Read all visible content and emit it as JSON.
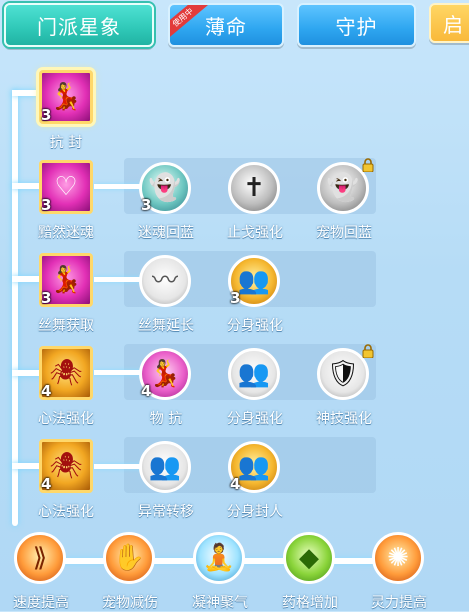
{
  "tabs": [
    {
      "label": "门派星象",
      "active": true
    },
    {
      "label": "薄命",
      "badge": "使用中"
    },
    {
      "label": "守护"
    },
    {
      "label": "启"
    }
  ],
  "tree": {
    "rows": [
      {
        "main": {
          "label": "抗 封",
          "level": "3",
          "icon": "dancer-icon"
        },
        "branches": []
      },
      {
        "main": {
          "label": "黯然迷魂",
          "level": "3",
          "icon": "heart-swirl-icon"
        },
        "branches": [
          {
            "label": "迷魂回蓝",
            "level": "3",
            "icon": "ghost-icon",
            "locked": false
          },
          {
            "label": "止戈强化",
            "level": "",
            "icon": "halberd-icon",
            "locked": false
          },
          {
            "label": "宠物回蓝",
            "level": "",
            "icon": "ghost-icon",
            "locked": true
          }
        ]
      },
      {
        "main": {
          "label": "丝舞获取",
          "level": "3",
          "icon": "dancer-icon"
        },
        "branches": [
          {
            "label": "丝舞延长",
            "level": "",
            "icon": "silk-icon",
            "locked": false
          },
          {
            "label": "分身强化",
            "level": "3",
            "icon": "clone-icon",
            "locked": false
          }
        ]
      },
      {
        "main": {
          "label": "心法强化",
          "level": "4",
          "icon": "spider-icon"
        },
        "branches": [
          {
            "label": "物 抗",
            "level": "4",
            "icon": "dancer-icon",
            "locked": false
          },
          {
            "label": "分身强化",
            "level": "",
            "icon": "clone-icon",
            "locked": false
          },
          {
            "label": "神技强化",
            "level": "",
            "icon": "armor-icon",
            "locked": true
          }
        ]
      },
      {
        "main": {
          "label": "心法强化",
          "level": "4",
          "icon": "spider-icon"
        },
        "branches": [
          {
            "label": "异常转移",
            "level": "",
            "icon": "clone-icon",
            "locked": false
          },
          {
            "label": "分身封人",
            "level": "4",
            "icon": "clone-icon",
            "locked": false
          }
        ]
      }
    ]
  },
  "bottom": [
    {
      "label": "速度提高",
      "icon": "speed-icon"
    },
    {
      "label": "宠物减伤",
      "icon": "shield-hand-icon"
    },
    {
      "label": "凝神聚气",
      "icon": "meditate-icon"
    },
    {
      "label": "药格增加",
      "icon": "gem-icon"
    },
    {
      "label": "灵力提高",
      "icon": "burst-icon"
    }
  ]
}
